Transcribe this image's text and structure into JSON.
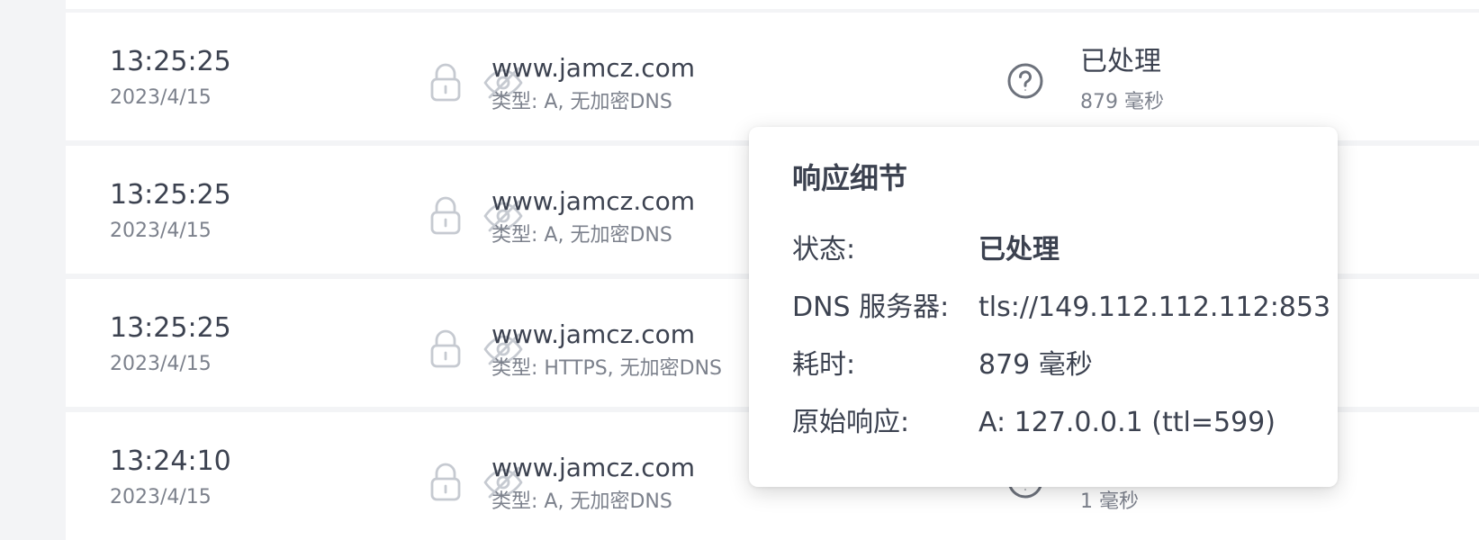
{
  "log_entries": [
    {
      "time": "13:25:25",
      "date": "2023/4/15",
      "domain": "www.jamcz.com",
      "query_type": "类型: A, 无加密DNS",
      "status": "已处理",
      "duration": "879 毫秒"
    },
    {
      "time": "13:25:25",
      "date": "2023/4/15",
      "domain": "www.jamcz.com",
      "query_type": "类型: A, 无加密DNS",
      "status": "",
      "duration": ""
    },
    {
      "time": "13:25:25",
      "date": "2023/4/15",
      "domain": "www.jamcz.com",
      "query_type": "类型: HTTPS, 无加密DNS",
      "status": "",
      "duration": ""
    },
    {
      "time": "13:24:10",
      "date": "2023/4/15",
      "domain": "www.jamcz.com",
      "query_type": "类型: A, 无加密DNS",
      "status": "",
      "duration": "1 毫秒"
    }
  ],
  "icons": {
    "lock": "lock-icon",
    "eye": "eye-off-icon",
    "help": "help-circle-icon"
  },
  "tooltip": {
    "title": "响应细节",
    "rows": [
      {
        "label": "状态:",
        "value": "已处理"
      },
      {
        "label": "DNS 服务器:",
        "value": "tls://149.112.112.112:853"
      },
      {
        "label": "耗时:",
        "value": "879 毫秒"
      },
      {
        "label": "原始响应:",
        "value": "A: 127.0.0.1 (ttl=599)"
      }
    ]
  },
  "colors": {
    "text_primary": "#3c4250",
    "text_secondary": "#7c818c",
    "icon_muted": "#c6cad1",
    "background": "#f3f4f6",
    "row_background": "#ffffff"
  }
}
